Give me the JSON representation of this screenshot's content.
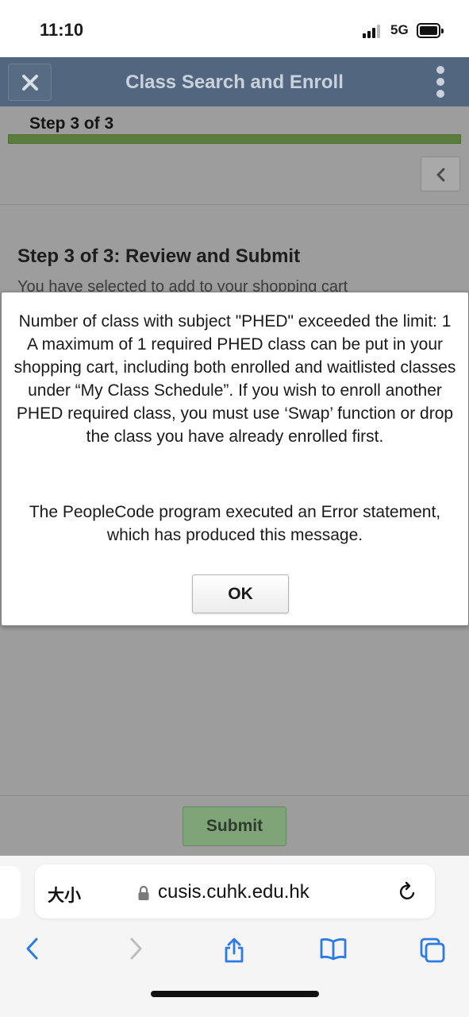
{
  "status_bar": {
    "time": "11:10",
    "network": "5G"
  },
  "header": {
    "title": "Class Search and Enroll",
    "close_icon": "close-icon",
    "more_icon": "more-vertical-icon"
  },
  "step": {
    "label": "Step 3 of 3",
    "progress": 1.0,
    "back_icon": "chevron-left-icon"
  },
  "content": {
    "section_title": "Step 3 of 3: Review and Submit",
    "partial_text": "You have selected to add to your shopping cart"
  },
  "dialog": {
    "message_main": "Number of class with subject \"PHED\" exceeded the limit: 1\nA maximum of 1 required PHED class can be put in your shopping cart, including both enrolled and waitlisted classes under “My Class Schedule”.  If you wish to enroll another PHED required class, you must use ‘Swap’ function or drop the class you have already enrolled first.",
    "message_detail": "The PeopleCode program executed an Error statement, which has produced this message.",
    "ok_label": "OK"
  },
  "footer": {
    "submit_label": "Submit"
  },
  "browser": {
    "text_size_label": "大小",
    "url": "cusis.cuhk.edu.hk",
    "icons": [
      "lock-icon",
      "reload-icon",
      "back-arrow-icon",
      "forward-arrow-icon",
      "share-icon",
      "bookmarks-icon",
      "tabs-icon"
    ]
  },
  "colors": {
    "header": "#52677f",
    "progress": "#5b7d3b",
    "submit": "#7fa478",
    "overlay": "#9d9d9d"
  }
}
